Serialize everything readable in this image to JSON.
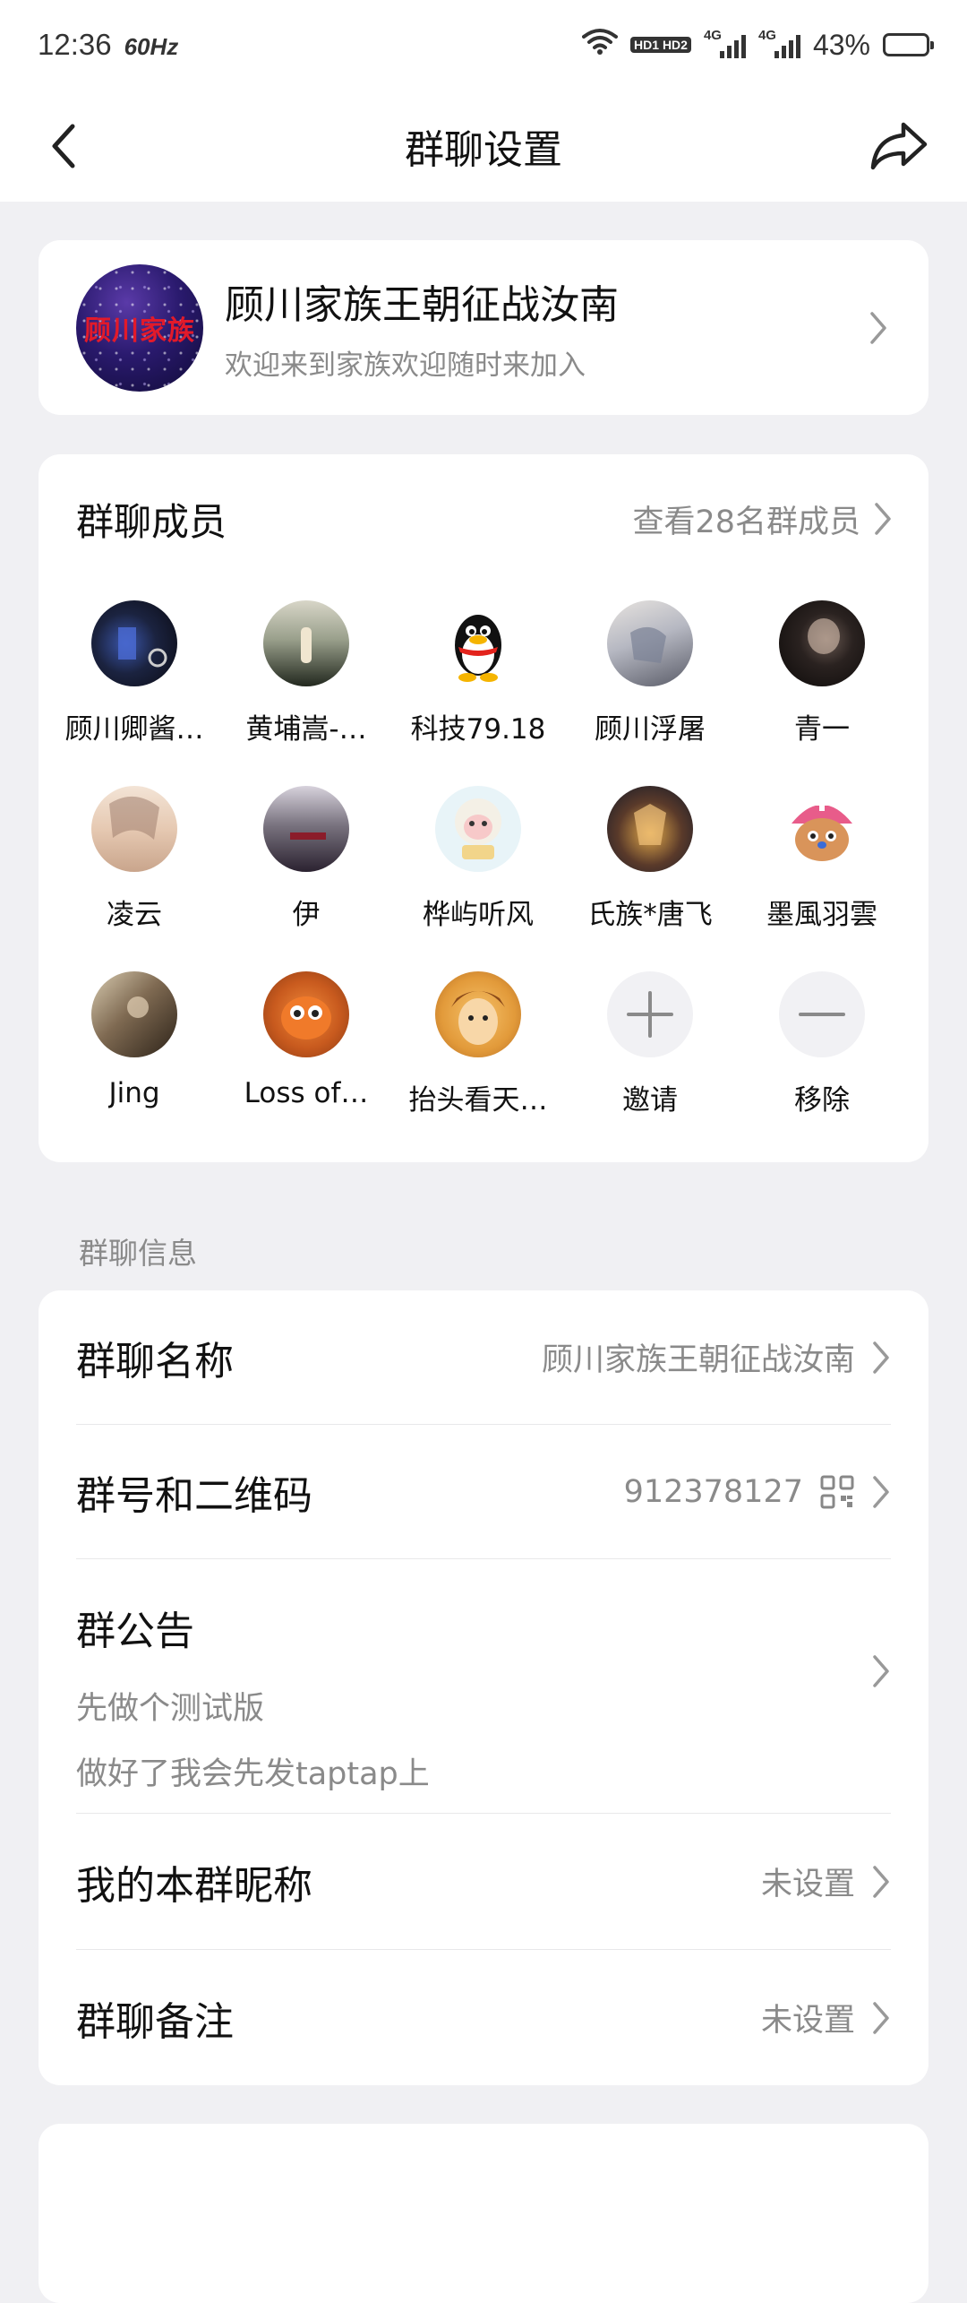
{
  "status_bar": {
    "time": "12:36",
    "refresh": "60Hz",
    "hd": "HD1 HD2",
    "network1": "4G",
    "network2": "4G",
    "battery": "43%"
  },
  "header": {
    "title": "群聊设置"
  },
  "group": {
    "avatar_text": "顾川家族",
    "name": "顾川家族王朝征战汝南",
    "description": "欢迎来到家族欢迎随时来加入"
  },
  "members": {
    "title": "群聊成员",
    "view_all": "查看28名群成员",
    "list": [
      {
        "name": "顾川卿酱…"
      },
      {
        "name": "黄埔嵩-…"
      },
      {
        "name": "科技79.18"
      },
      {
        "name": "顾川浮屠"
      },
      {
        "name": "青一"
      },
      {
        "name": "凌云"
      },
      {
        "name": "伊"
      },
      {
        "name": "桦屿听风"
      },
      {
        "name": "氏族*唐飞"
      },
      {
        "name": "墨風羽雲"
      },
      {
        "name": "Jing"
      },
      {
        "name": "Loss of…"
      },
      {
        "name": "抬头看天…"
      }
    ],
    "invite_label": "邀请",
    "remove_label": "移除"
  },
  "info_section": {
    "label": "群聊信息",
    "name_label": "群聊名称",
    "name_value": "顾川家族王朝征战汝南",
    "id_label": "群号和二维码",
    "id_value": "912378127",
    "notice_label": "群公告",
    "notice_line1": "先做个测试版",
    "notice_line2": "做好了我会先发taptap上",
    "nickname_label": "我的本群昵称",
    "nickname_value": "未设置",
    "remark_label": "群聊备注",
    "remark_value": "未设置"
  },
  "colors": {
    "background": "#f0f0f3",
    "card": "#ffffff",
    "secondary_text": "#8a8a8a",
    "primary_text": "#111111"
  }
}
